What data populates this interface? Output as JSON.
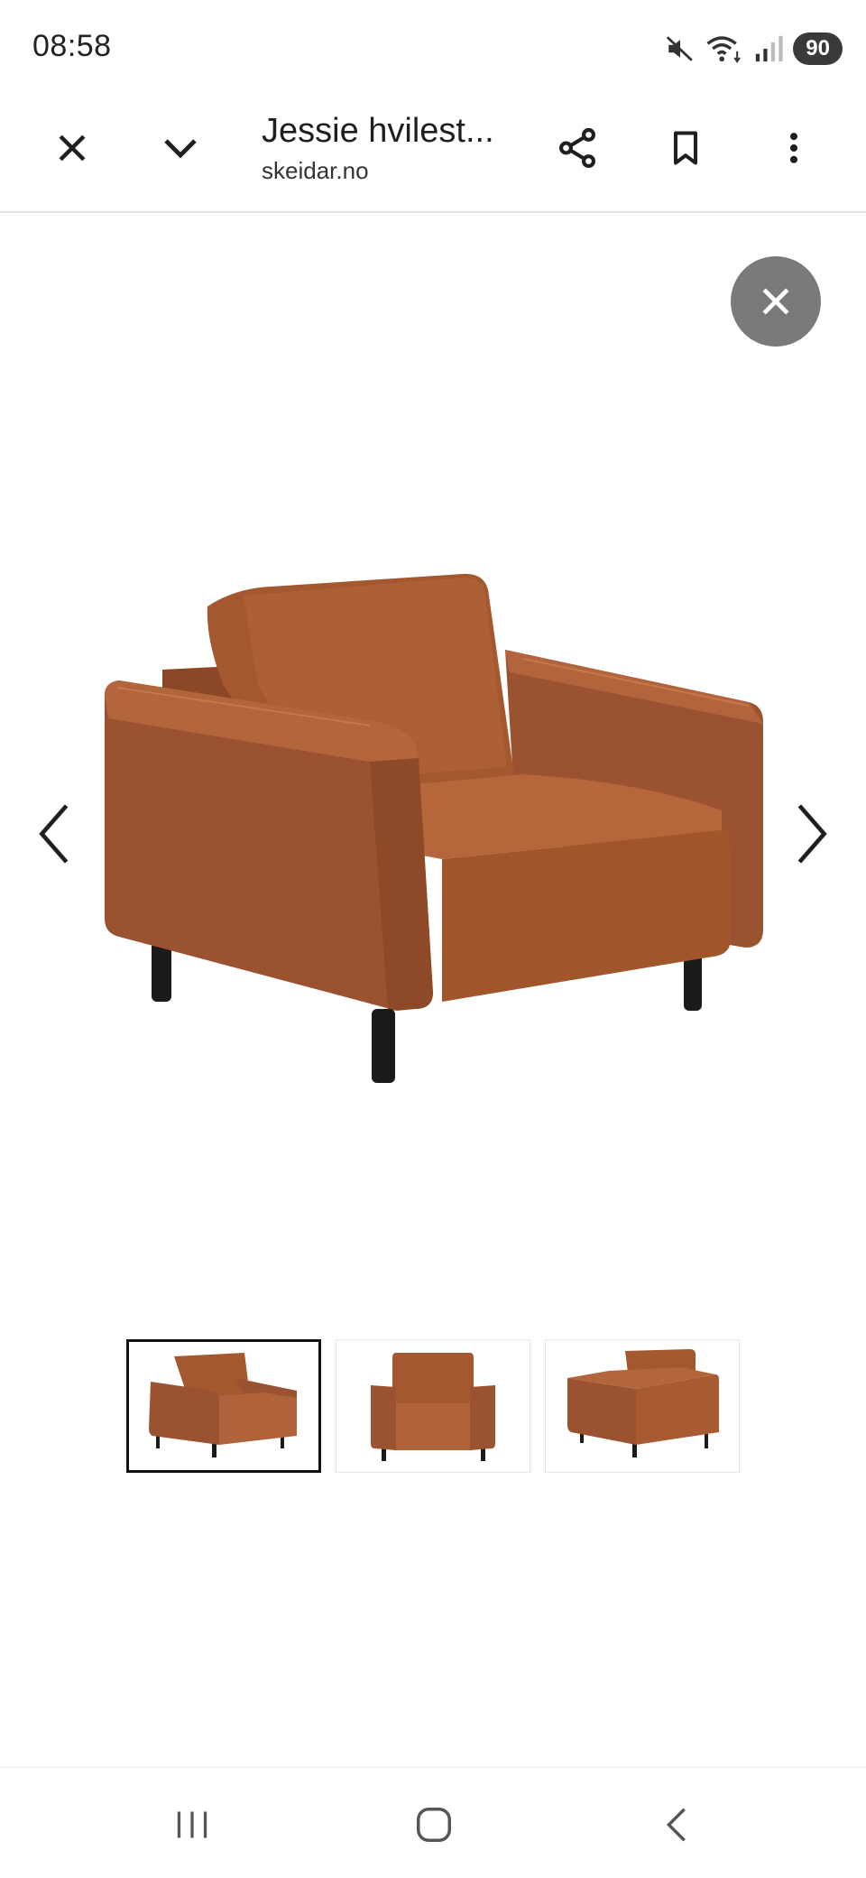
{
  "status_bar": {
    "time": "08:58",
    "battery": "90",
    "icons": [
      "mute-icon",
      "wifi-icon",
      "signal-icon",
      "battery-icon"
    ]
  },
  "toolbar": {
    "title": "Jessie hvilest...",
    "domain": "skeidar.no",
    "icons": [
      "close-icon",
      "chevron-down-icon",
      "share-icon",
      "bookmark-icon",
      "more-vert-icon"
    ]
  },
  "viewer": {
    "product_color": "#a3582f",
    "thumbnail_count": 3,
    "selected_thumbnail": 1
  },
  "nav_bar": {
    "icons": [
      "recent-apps-icon",
      "home-icon",
      "back-icon"
    ]
  }
}
